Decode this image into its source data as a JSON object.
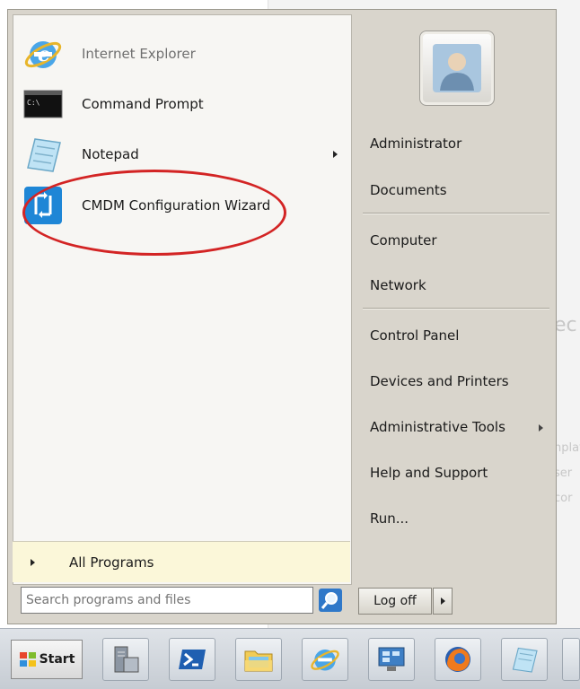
{
  "background": {
    "fragment_1": "ec",
    "fragment_2": "nplat",
    "fragment_3": "ser",
    "fragment_4": "cor"
  },
  "pinned_programs": [
    {
      "label": "Internet Explorer",
      "icon": "internet-explorer-icon"
    },
    {
      "label": "Command Prompt",
      "icon": "command-prompt-icon",
      "icon_text": "C:\\"
    },
    {
      "label": "Notepad",
      "icon": "notepad-icon"
    },
    {
      "label": "CMDM Configuration Wizard",
      "icon": "cmdm-wizard-icon"
    }
  ],
  "all_programs": "All Programs",
  "search": {
    "placeholder": "Search programs and files"
  },
  "right_pane": {
    "user": "Administrator",
    "items": [
      "Documents",
      "Computer",
      "Network",
      "Control Panel",
      "Devices and Printers",
      "Administrative Tools",
      "Help and Support",
      "Run..."
    ]
  },
  "logoff": "Log off",
  "taskbar": {
    "start": "Start",
    "buttons": [
      "server-manager-icon",
      "powershell-icon",
      "file-explorer-icon",
      "internet-explorer-icon",
      "remote-desktop-icon",
      "firefox-icon",
      "notepad-icon"
    ]
  },
  "colors": {
    "highlight_ring": "#d32424",
    "all_programs_bg": "#fbf7d9",
    "menu_bg": "#d9d5cc"
  }
}
